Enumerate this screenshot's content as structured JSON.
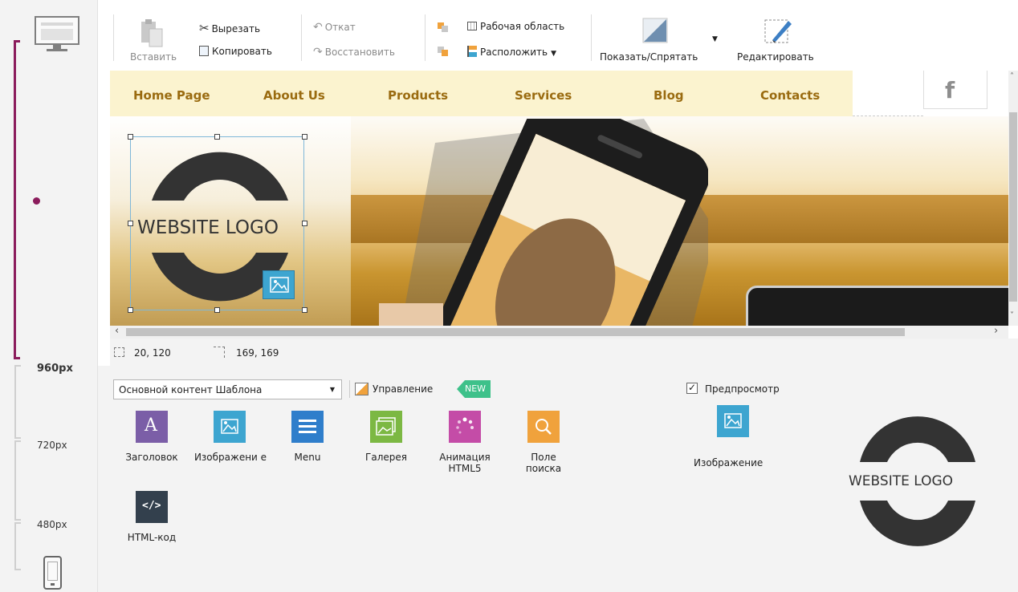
{
  "toolbar": {
    "paste_label": "Вставить",
    "cut_label": "Вырезать",
    "copy_label": "Копировать",
    "undo_label": "Откат",
    "redo_label": "Восстановить",
    "workspace_label": "Рабочая область",
    "arrange_label": "Расположить",
    "showhide_label": "Показать/Спрятать",
    "edit_label": "Редактировать"
  },
  "site": {
    "nav": [
      "Home Page",
      "About Us",
      "Products",
      "Services",
      "Blog",
      "Contacts"
    ],
    "logo_text": "WEBSITE LOGO",
    "social_icon": "f"
  },
  "status": {
    "position": "20, 120",
    "size": "169, 169"
  },
  "breakpoints": {
    "b960": "960px",
    "b720": "720px",
    "b480": "480px"
  },
  "panel": {
    "dropdown_value": "Основной контент Шаблона",
    "manage_label": "Управление",
    "new_badge": "NEW",
    "preview_label": "Предпросмотр",
    "preview_item_label": "Изображение",
    "preview_logo_text": "WEBSITE LOGO",
    "widgets": [
      {
        "label": "Заголовок",
        "icon": "heading-icon",
        "color": "#7b5ea7"
      },
      {
        "label": "Изображени е",
        "icon": "image-icon",
        "color": "#3da5d0"
      },
      {
        "label": "Menu",
        "icon": "menu-icon",
        "color": "#2f7ecb"
      },
      {
        "label": "Галерея",
        "icon": "gallery-icon",
        "color": "#7cb843"
      },
      {
        "label": "Анимация HTML5",
        "icon": "animation-icon",
        "color": "#c44ca7"
      },
      {
        "label": "Поле поиска",
        "icon": "search-icon",
        "color": "#f0a23c"
      },
      {
        "label": "HTML-код",
        "icon": "code-icon",
        "color": "#33404d"
      }
    ]
  },
  "colors": {
    "accent_purple": "#8b1c5c",
    "nav_bg": "#fbf3cf",
    "nav_text": "#9a6b10"
  }
}
